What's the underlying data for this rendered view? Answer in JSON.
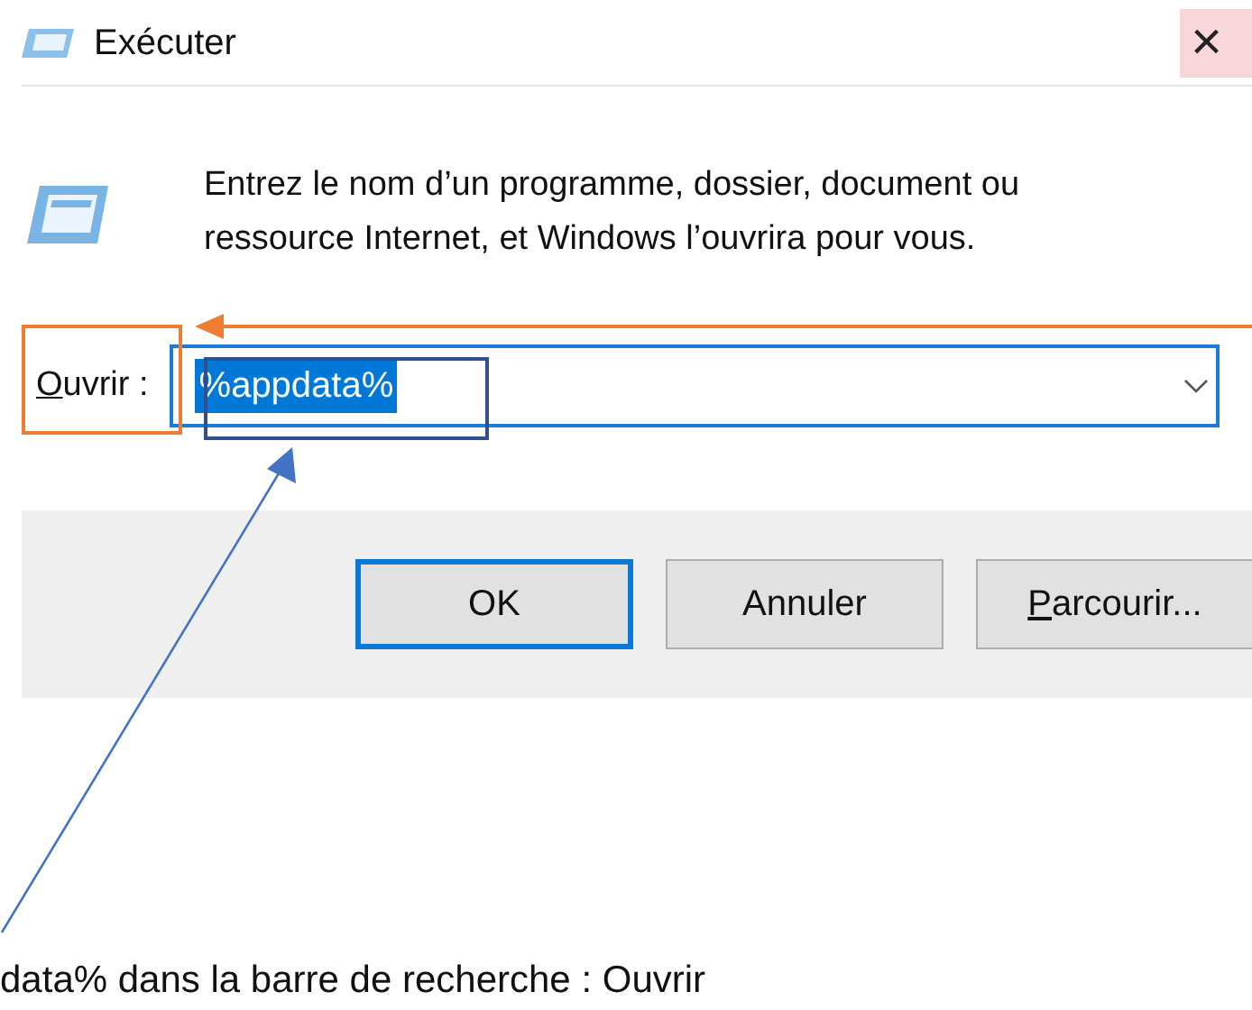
{
  "window": {
    "title": "Exécuter",
    "close": "×"
  },
  "description": "Entrez le nom d’un programme, dossier, document ou ressource Internet, et Windows l’ouvrira pour vous.",
  "open_field": {
    "label": "Ouvrir :",
    "label_underline_first": true,
    "value": "%appdata%",
    "value_selected": true
  },
  "buttons": [
    {
      "label": "OK",
      "default": true,
      "underline_first": false
    },
    {
      "label": "Annuler",
      "default": false,
      "underline_first": false
    },
    {
      "label": "Parcourir...",
      "default": false,
      "underline_first": true
    }
  ],
  "caption": "data% dans la barre de recherche :    Ouvrir"
}
